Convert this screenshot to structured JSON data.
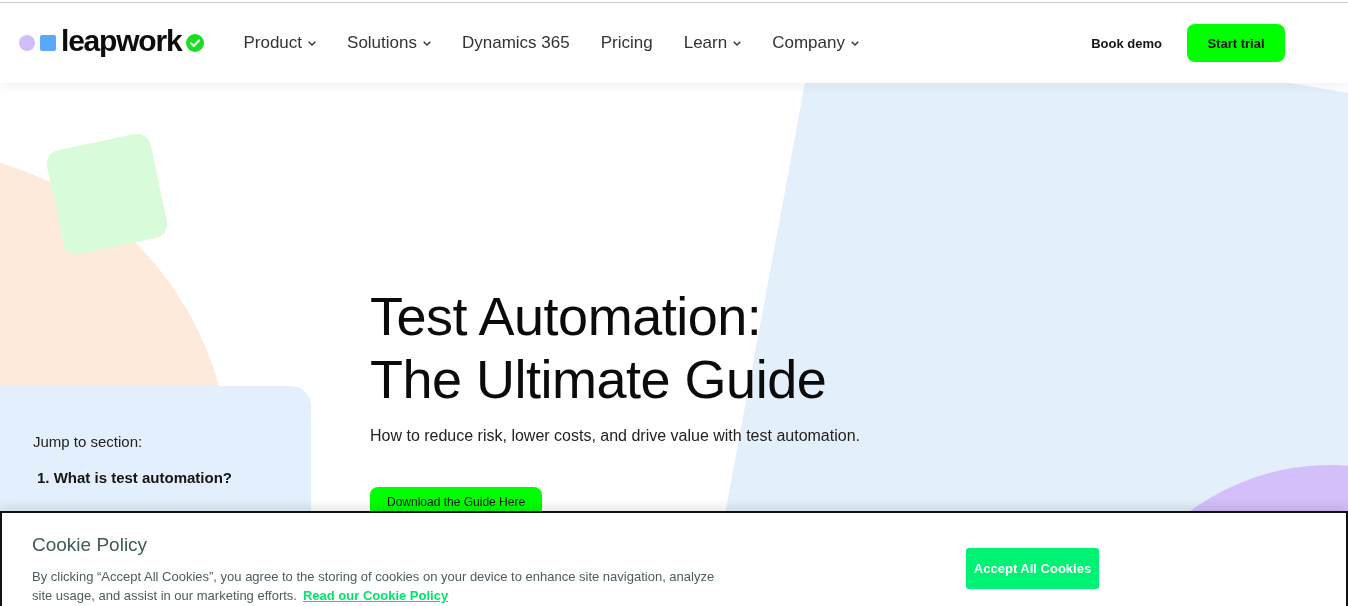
{
  "header": {
    "logo": {
      "wordmark": "leapwork"
    },
    "nav": [
      {
        "label": "Product",
        "has_menu": true
      },
      {
        "label": "Solutions",
        "has_menu": true
      },
      {
        "label": "Dynamics 365",
        "has_menu": false
      },
      {
        "label": "Pricing",
        "has_menu": false
      },
      {
        "label": "Learn",
        "has_menu": true
      },
      {
        "label": "Company",
        "has_menu": true
      }
    ],
    "book_demo": "Book demo",
    "start_trial": "Start trial"
  },
  "hero": {
    "title": "Test Automation: The Ultimate Guide",
    "subtitle": "How to reduce risk, lower costs, and drive value with test automation.",
    "download_button": "Download the Guide Here"
  },
  "sidebar": {
    "heading": "Jump to section:",
    "items": [
      {
        "label": "1. What is test automation?"
      }
    ]
  },
  "cookie_banner": {
    "title": "Cookie Policy",
    "text": "By clicking “Accept All Cookies”, you agree to the storing of cookies on your device to enhance site navigation, analyze site usage, and assist in our marketing efforts.",
    "link": "Read our Cookie Policy",
    "accept_button": "Accept All Cookies"
  }
}
